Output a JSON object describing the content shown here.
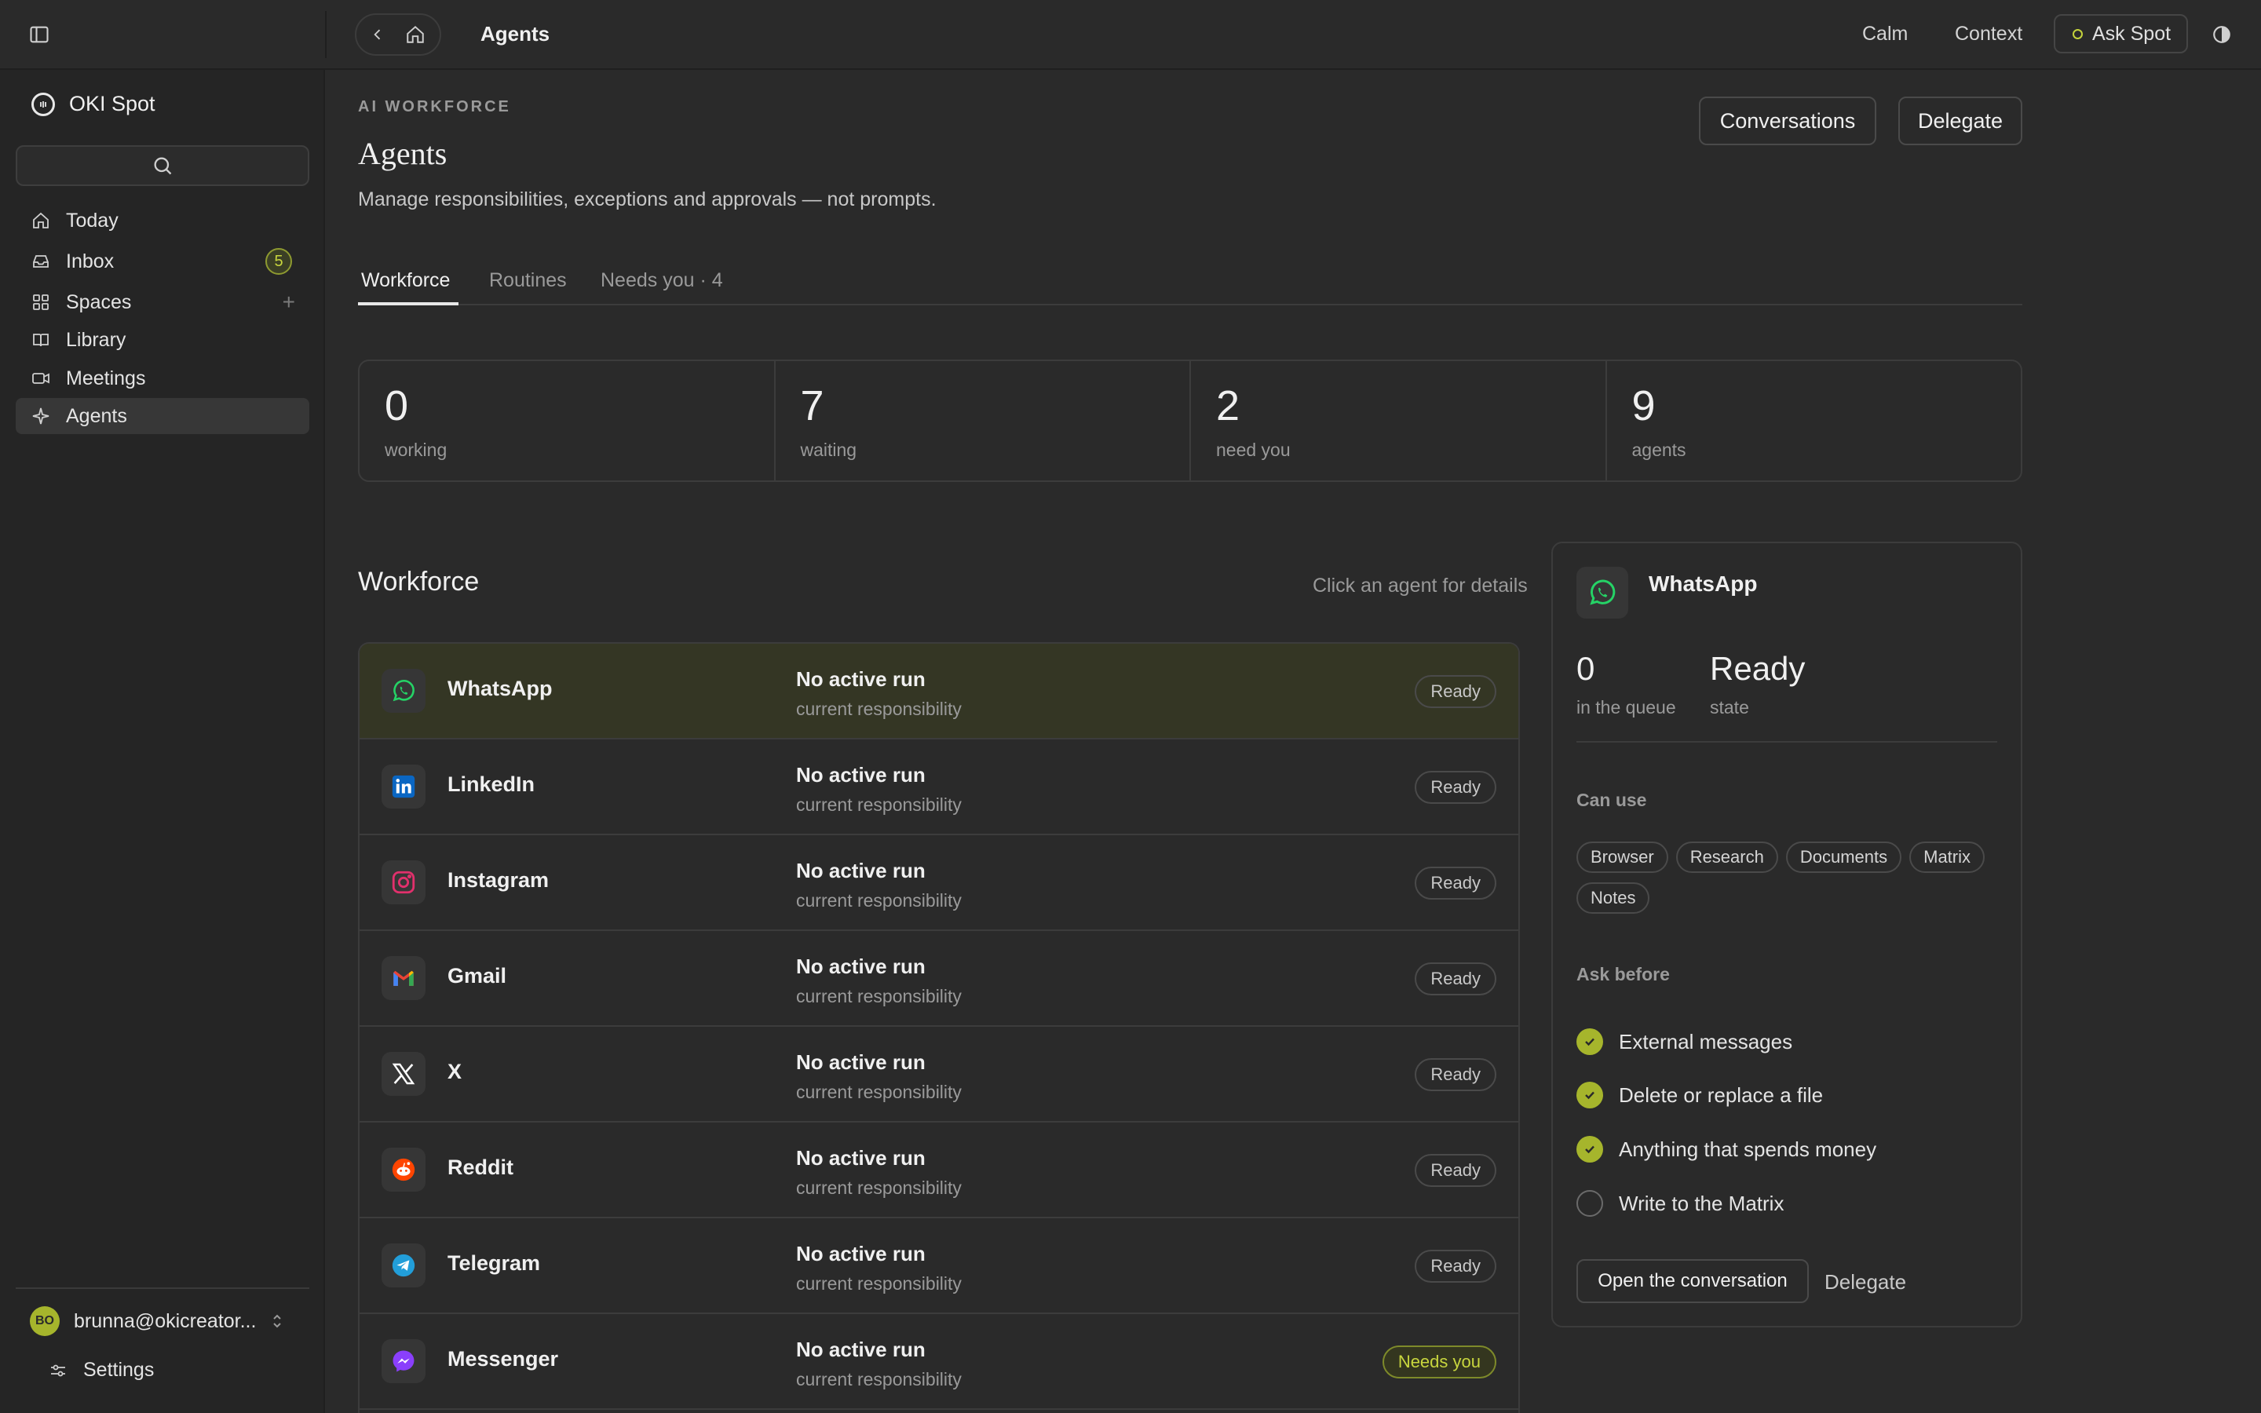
{
  "topbar": {
    "title": "Agents",
    "calm_label": "Calm",
    "context_label": "Context",
    "ask_label": "Ask Spot"
  },
  "sidebar": {
    "brand": "OKI Spot",
    "items": [
      {
        "label": "Today",
        "icon": "home-icon"
      },
      {
        "label": "Inbox",
        "icon": "inbox-icon",
        "badge": "5"
      },
      {
        "label": "Spaces",
        "icon": "grid-icon",
        "action": "+"
      },
      {
        "label": "Library",
        "icon": "book-icon"
      },
      {
        "label": "Meetings",
        "icon": "video-icon"
      },
      {
        "label": "Agents",
        "icon": "sparkle-icon",
        "active": true
      }
    ],
    "user": {
      "initials": "BO",
      "email": "brunna@okicreator..."
    },
    "settings_label": "Settings"
  },
  "header": {
    "kicker": "AI WORKFORCE",
    "title": "Agents",
    "subtitle": "Manage responsibilities, exceptions and approvals — not prompts.",
    "conversations_label": "Conversations",
    "delegate_label": "Delegate"
  },
  "tabs": [
    {
      "label": "Workforce",
      "active": true
    },
    {
      "label": "Routines"
    },
    {
      "label": "Needs you · 4"
    }
  ],
  "stats": [
    {
      "value": "0",
      "label": "working"
    },
    {
      "value": "7",
      "label": "waiting"
    },
    {
      "value": "2",
      "label": "need you"
    },
    {
      "value": "9",
      "label": "agents"
    }
  ],
  "workforce": {
    "title": "Workforce",
    "hint": "Click an agent for details",
    "agents": [
      {
        "name": "WhatsApp",
        "run": "No active run",
        "resp": "current responsibility",
        "status": "Ready",
        "icon": "whatsapp-icon",
        "color": "#25d366"
      },
      {
        "name": "LinkedIn",
        "run": "No active run",
        "resp": "current responsibility",
        "status": "Ready",
        "icon": "linkedin-icon",
        "color": "#0a66c2"
      },
      {
        "name": "Instagram",
        "run": "No active run",
        "resp": "current responsibility",
        "status": "Ready",
        "icon": "instagram-icon",
        "color": "#e1306c"
      },
      {
        "name": "Gmail",
        "run": "No active run",
        "resp": "current responsibility",
        "status": "Ready",
        "icon": "gmail-icon",
        "color": "#ea4335"
      },
      {
        "name": "X",
        "run": "No active run",
        "resp": "current responsibility",
        "status": "Ready",
        "icon": "x-icon",
        "color": "#ffffff"
      },
      {
        "name": "Reddit",
        "run": "No active run",
        "resp": "current responsibility",
        "status": "Ready",
        "icon": "reddit-icon",
        "color": "#ff4500"
      },
      {
        "name": "Telegram",
        "run": "No active run",
        "resp": "current responsibility",
        "status": "Ready",
        "icon": "telegram-icon",
        "color": "#229ed9"
      },
      {
        "name": "Messenger",
        "run": "No active run",
        "resp": "current responsibility",
        "status": "Needs you",
        "icon": "messenger-icon",
        "color": "#a334fa"
      }
    ]
  },
  "detail": {
    "name": "WhatsApp",
    "queue_value": "0",
    "queue_label": "in the queue",
    "state_value": "Ready",
    "state_label": "state",
    "can_use_label": "Can use",
    "tools": [
      "Browser",
      "Research",
      "Documents",
      "Matrix",
      "Notes"
    ],
    "ask_before_label": "Ask before",
    "ask_before": [
      {
        "label": "External messages",
        "checked": true
      },
      {
        "label": "Delete or replace a file",
        "checked": true
      },
      {
        "label": "Anything that spends money",
        "checked": true
      },
      {
        "label": "Write to the Matrix",
        "checked": false
      }
    ],
    "open_label": "Open the conversation",
    "delegate_label": "Delegate"
  },
  "colors": {
    "accent": "#a6b52c",
    "background": "#2a2a2a",
    "sidebar": "#252525",
    "selected_row": "#343624"
  }
}
